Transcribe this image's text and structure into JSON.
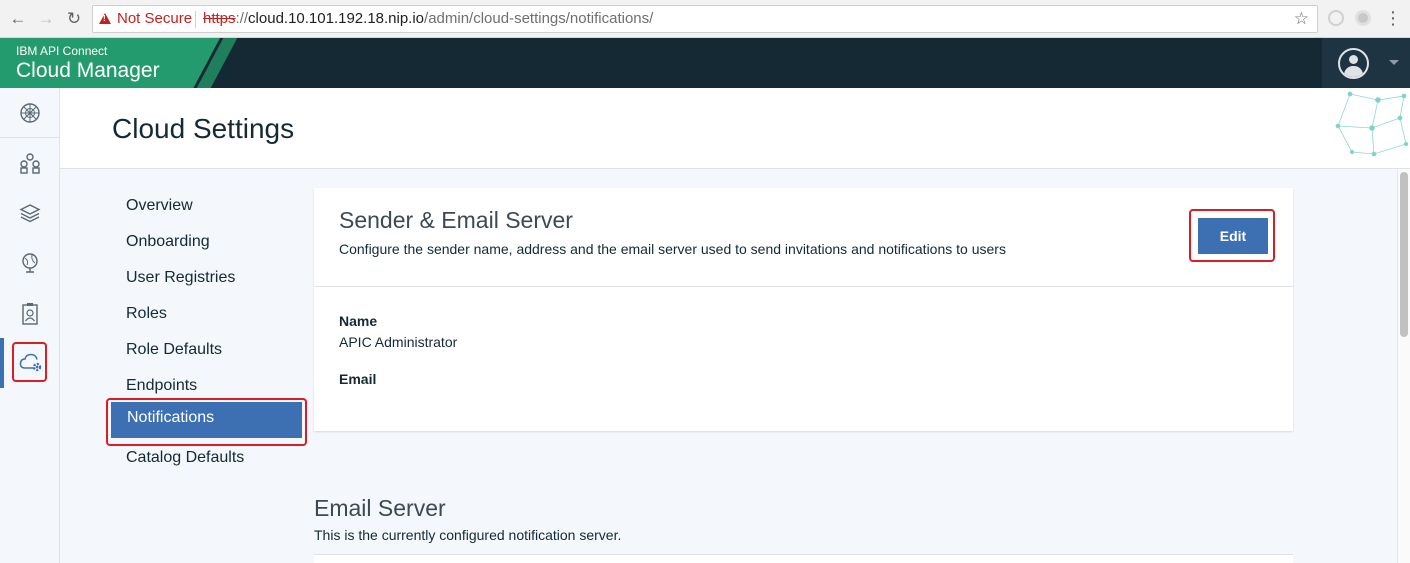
{
  "browser": {
    "security_label": "Not Secure",
    "url_scheme": "https",
    "url_sep": "://",
    "url_host": "cloud.10.101.192.18.nip.io",
    "url_path": "/admin/cloud-settings/notifications/",
    "back_icon": "←",
    "forward_icon": "→",
    "reload_icon": "↻",
    "star_icon": "☆",
    "menu_icon": "⋮"
  },
  "header": {
    "product": "IBM API Connect",
    "app_name": "Cloud Manager",
    "brand_color": "#249b6f",
    "bar_color": "#152934"
  },
  "side_rail": {
    "items": [
      {
        "name": "dashboard-icon"
      },
      {
        "name": "topology-icon"
      },
      {
        "name": "resources-icon"
      },
      {
        "name": "provider-orgs-icon"
      },
      {
        "name": "members-icon"
      },
      {
        "name": "cloud-settings-icon",
        "active": true
      }
    ],
    "accent_color": "#3d70b2"
  },
  "page": {
    "title": "Cloud Settings"
  },
  "settings_nav": {
    "items": [
      {
        "label": "Overview"
      },
      {
        "label": "Onboarding"
      },
      {
        "label": "User Registries"
      },
      {
        "label": "Roles"
      },
      {
        "label": "Role Defaults"
      },
      {
        "label": "Endpoints"
      },
      {
        "label": "Notifications",
        "selected": true
      },
      {
        "label": "Catalog Defaults"
      }
    ]
  },
  "sender_card": {
    "title": "Sender & Email Server",
    "description": "Configure the sender name, address and the email server used to send invitations and notifications to users",
    "edit_label": "Edit",
    "fields": [
      {
        "label": "Name",
        "value": "APIC Administrator"
      },
      {
        "label": "Email",
        "value": ""
      }
    ]
  },
  "email_server": {
    "title": "Email Server",
    "description": "This is the currently configured notification server."
  },
  "highlight_color": "#d91e26"
}
